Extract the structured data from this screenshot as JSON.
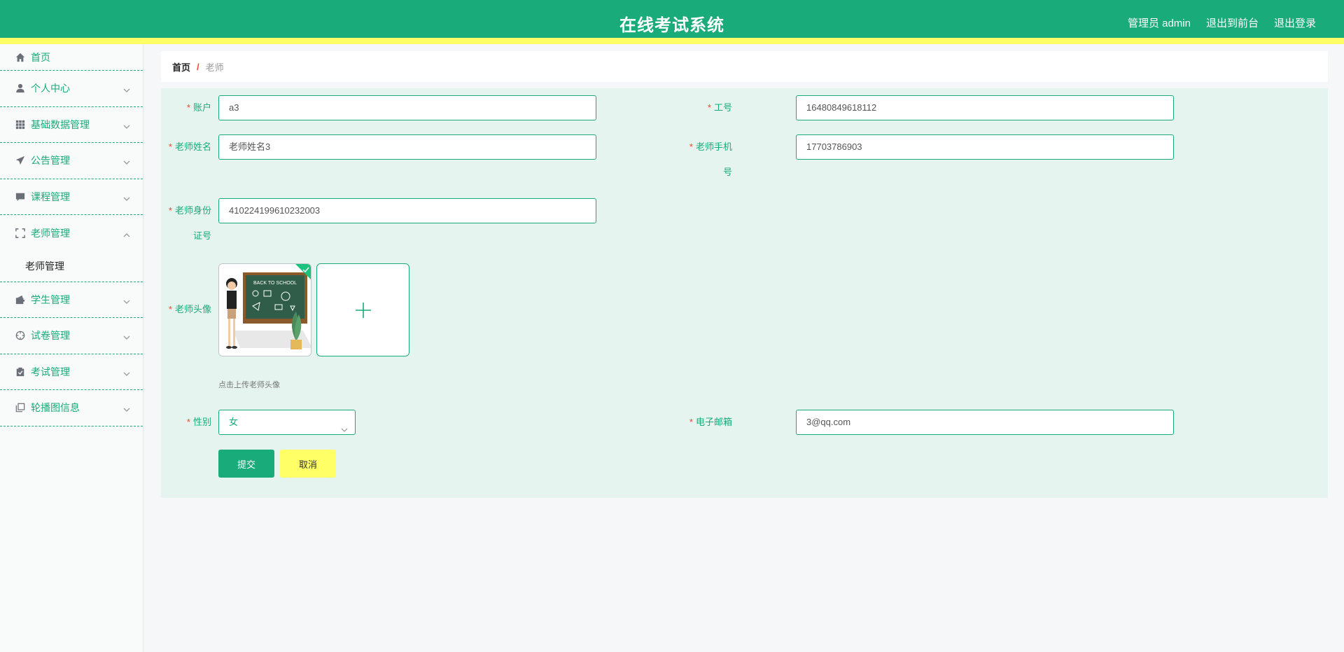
{
  "header": {
    "title": "在线考试系统",
    "user_label": "管理员 admin",
    "front_link": "退出到前台",
    "logout": "退出登录"
  },
  "sidebar": {
    "items": [
      {
        "label": "首页",
        "icon": "home-icon"
      },
      {
        "label": "个人中心",
        "icon": "user-icon"
      },
      {
        "label": "基础数据管理",
        "icon": "grid-icon"
      },
      {
        "label": "公告管理",
        "icon": "send-icon"
      },
      {
        "label": "课程管理",
        "icon": "chat-icon"
      },
      {
        "label": "老师管理",
        "icon": "fullscreen-icon"
      },
      {
        "label": "学生管理",
        "icon": "wallet-icon"
      },
      {
        "label": "试卷管理",
        "icon": "compass-icon"
      },
      {
        "label": "考试管理",
        "icon": "clipboard-icon"
      },
      {
        "label": "轮播图信息",
        "icon": "copy-icon"
      }
    ],
    "submenu_label": "老师管理"
  },
  "breadcrumb": {
    "home": "首页",
    "separator": "/",
    "current": "老师"
  },
  "form": {
    "account": {
      "label": "账户",
      "value": "a3"
    },
    "job_no": {
      "label": "工号",
      "value": "16480849618112"
    },
    "name": {
      "label": "老师姓名",
      "value": "老师姓名3"
    },
    "phone": {
      "label_1": "老师手机",
      "label_2": "号",
      "value": "17703786903"
    },
    "id_card": {
      "label_1": "老师身份",
      "label_2": "证号",
      "value": "410224199610232003"
    },
    "avatar": {
      "label": "老师头像",
      "hint": "点击上传老师头像",
      "image_text": "BACK TO SCHOOL"
    },
    "gender": {
      "label": "性别",
      "value": "女"
    },
    "email": {
      "label": "电子邮箱",
      "value": "3@qq.com"
    },
    "required_mark": "*"
  },
  "buttons": {
    "submit": "提交",
    "cancel": "取消"
  },
  "colors": {
    "primary": "#19ab7a",
    "accent": "#ffff66",
    "required": "#e8492f",
    "panel_bg": "#e5f4ee"
  }
}
